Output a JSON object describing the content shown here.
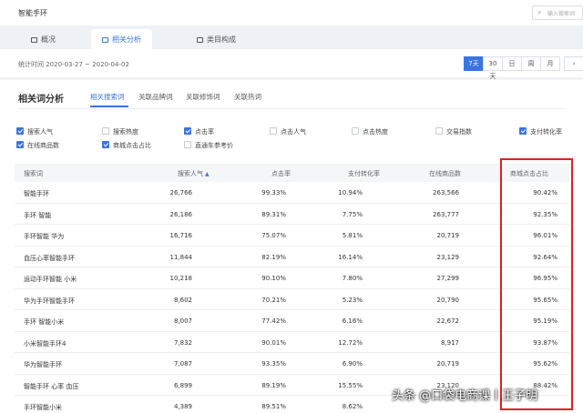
{
  "header": {
    "title": "智能手环",
    "search_placeholder": "输入搜索词",
    "search_icon": "search-icon"
  },
  "tabs": [
    {
      "label": "概况",
      "active": false
    },
    {
      "label": "相关分析",
      "active": true
    },
    {
      "label": "类目构成",
      "active": false
    }
  ],
  "date_range": "统计时间 2020-03-27 ~ 2020-04-02",
  "periods": [
    "7天",
    "30天",
    "日",
    "周",
    "月"
  ],
  "period_active": "7天",
  "section": {
    "title": "相关词分析",
    "subtabs": [
      "相关搜索词",
      "关联品牌词",
      "关联修饰词",
      "关联热词"
    ],
    "active_subtab": "相关搜索词"
  },
  "options": [
    {
      "label": "搜索人气",
      "checked": true
    },
    {
      "label": "搜索热度",
      "checked": false
    },
    {
      "label": "点击率",
      "checked": true
    },
    {
      "label": "点击人气",
      "checked": false
    },
    {
      "label": "点击热度",
      "checked": false
    },
    {
      "label": "交易指数",
      "checked": false
    },
    {
      "label": "支付转化率",
      "checked": true
    },
    {
      "label": "在线商品数",
      "checked": true
    },
    {
      "label": "商城点击占比",
      "checked": true
    },
    {
      "label": "直通车参考价",
      "checked": false
    }
  ],
  "table": {
    "headers": [
      "搜索词",
      "搜索人气",
      "点击率",
      "支付转化率",
      "在线商品数",
      "商城点击占比"
    ],
    "sort_indicator": "▲",
    "rows": [
      [
        "智能手环",
        "26,766",
        "99.33%",
        "10.94%",
        "263,566",
        "90.42%"
      ],
      [
        "手环 智能",
        "26,186",
        "89.31%",
        "7.75%",
        "263,777",
        "92.35%"
      ],
      [
        "手环智能 华为",
        "16,716",
        "75.07%",
        "5.81%",
        "20,719",
        "96.01%"
      ],
      [
        "血压心率智能手环",
        "11,844",
        "82.19%",
        "16.14%",
        "23,129",
        "92.64%"
      ],
      [
        "运动手环智能 小米",
        "10,218",
        "90.10%",
        "7.80%",
        "27,299",
        "96.95%"
      ],
      [
        "华为手环智能手环",
        "8,602",
        "70.21%",
        "5.23%",
        "20,790",
        "95.65%"
      ],
      [
        "手环 智能小米",
        "8,007",
        "77.42%",
        "6.16%",
        "22,672",
        "95.19%"
      ],
      [
        "小米智能手环4",
        "7,832",
        "90.01%",
        "12.72%",
        "8,917",
        "93.87%"
      ],
      [
        "华为智能手环",
        "7,087",
        "93.35%",
        "6.90%",
        "20,719",
        "95.62%"
      ],
      [
        "智能手环 心率 血压",
        "6,899",
        "89.19%",
        "15.55%",
        "23,120",
        "88.42%"
      ],
      [
        "手环智能小米",
        "4,389",
        "89.51%",
        "8.62%",
        "",
        ""
      ]
    ]
  },
  "watermark": "头条 @口袋电商课丨王子明",
  "colors": {
    "accent": "#3a74e0",
    "highlight_box": "#e02020"
  }
}
